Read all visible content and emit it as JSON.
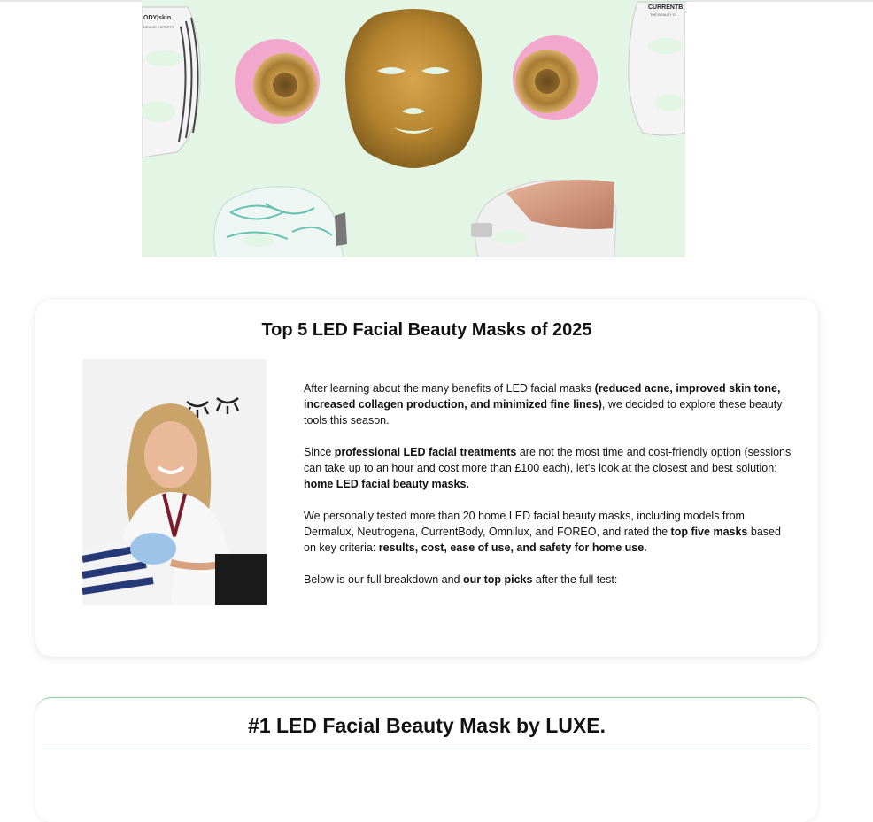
{
  "hero": {
    "image_alt": "Assortment of LED facial beauty masks",
    "brand_left_line1": "ODY|skin",
    "brand_left_line2": "DEVICE EXPERTS",
    "brand_right_line1": "CURRENTB",
    "brand_right_line2": "THE BEAUTY D"
  },
  "intro": {
    "title": "Top 5 LED Facial Beauty Masks of 2025",
    "p1": [
      {
        "t": "After learning about the many benefits of LED facial masks "
      },
      {
        "t": "(reduced acne, improved skin tone, increased collagen production, and minimized fine lines)",
        "b": true
      },
      {
        "t": ", we decided to explore these beauty tools this season."
      }
    ],
    "p2": [
      {
        "t": "Since "
      },
      {
        "t": "professional LED facial treatments",
        "b": true
      },
      {
        "t": " are not the most time and cost-friendly option (sessions can take up to an hour and cost more than £100 each), let's look at the closest and best solution: "
      },
      {
        "t": "home LED facial beauty masks.",
        "b": true
      }
    ],
    "p3": [
      {
        "t": "We personally tested more than 20 home LED facial beauty masks, including models from Dermalux, Neutrogena, CurrentBody, Omnilux, and FOREO, and rated the "
      },
      {
        "t": "top five masks",
        "b": true
      },
      {
        "t": " based on key criteria: "
      },
      {
        "t": "results, cost, ease of use, and safety for home use.",
        "b": true
      }
    ],
    "p4": [
      {
        "t": "Below is our full breakdown and "
      },
      {
        "t": "our top picks",
        "b": true
      },
      {
        "t": " after the full test:"
      }
    ]
  },
  "product": {
    "title": "#1 LED Facial Beauty Mask by LUXE."
  },
  "colors": {
    "hero_bg": "#e3f5e4",
    "gold": "#b88a36",
    "pink": "#f2a8cc",
    "accent_green": "#8fcf9b"
  }
}
